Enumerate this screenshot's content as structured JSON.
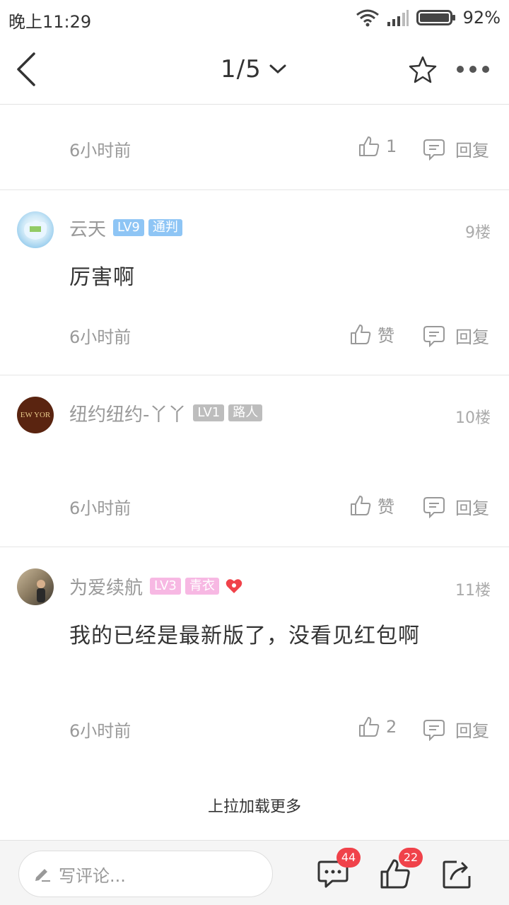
{
  "status_bar": {
    "time": "晚上11:29",
    "battery": "92%"
  },
  "nav": {
    "page_indicator": "1/5"
  },
  "comments": [
    {
      "time": "6小时前",
      "like_label": "1",
      "reply_label": "回复"
    },
    {
      "username": "云天",
      "level": "LV9",
      "title": "通判",
      "floor": "9楼",
      "text": "厉害啊",
      "time": "6小时前",
      "like_label": "赞",
      "reply_label": "回复"
    },
    {
      "username": "纽约纽约-丫丫",
      "level": "LV1",
      "title": "路人",
      "floor": "10楼",
      "text": "",
      "time": "6小时前",
      "like_label": "赞",
      "reply_label": "回复",
      "avatar_text": "EW YOR"
    },
    {
      "username": "为爱续航",
      "level": "LV3",
      "title": "青衣",
      "floor": "11楼",
      "text": "我的已经是最新版了，没看见红包啊",
      "time": "6小时前",
      "like_label": "2",
      "reply_label": "回复"
    }
  ],
  "load_more": "上拉加载更多",
  "bottom_bar": {
    "input_placeholder": "写评论...",
    "comment_count": "44",
    "like_count": "22"
  },
  "colors": {
    "accent_red": "#f0424a",
    "lv9_badge": "#8ec5f5",
    "lv1_badge": "#bdbdbd",
    "lv3_badge": "#f7b8e3"
  }
}
